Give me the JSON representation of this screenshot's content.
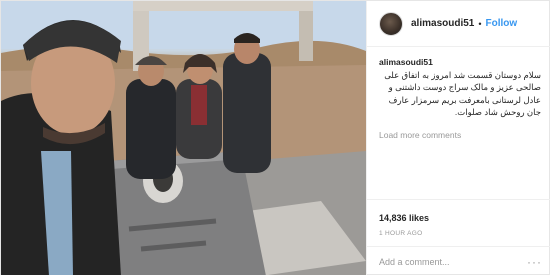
{
  "header": {
    "username": "alimasoudi51",
    "separator": "•",
    "follow_label": "Follow"
  },
  "caption": {
    "username": "alimasoudi51",
    "text": "سلام دوستان قسمت شد امروز به اتفاق علی صالحی عزیز و مالک سراج دوست داشتنی و عادل لرستانی بامعرفت بریم سرمزار عارف جان روحش شاد صلوات."
  },
  "load_more_label": "Load more comments",
  "likes_label": "14,836 likes",
  "timestamp": "1 HOUR AGO",
  "comment": {
    "placeholder": "Add a comment...",
    "more_icon": "···"
  },
  "icons": {
    "avatar": "profile-avatar",
    "more": "more-options-icon"
  },
  "colors": {
    "accent": "#3897f0",
    "muted": "#999999",
    "text": "#262626"
  }
}
